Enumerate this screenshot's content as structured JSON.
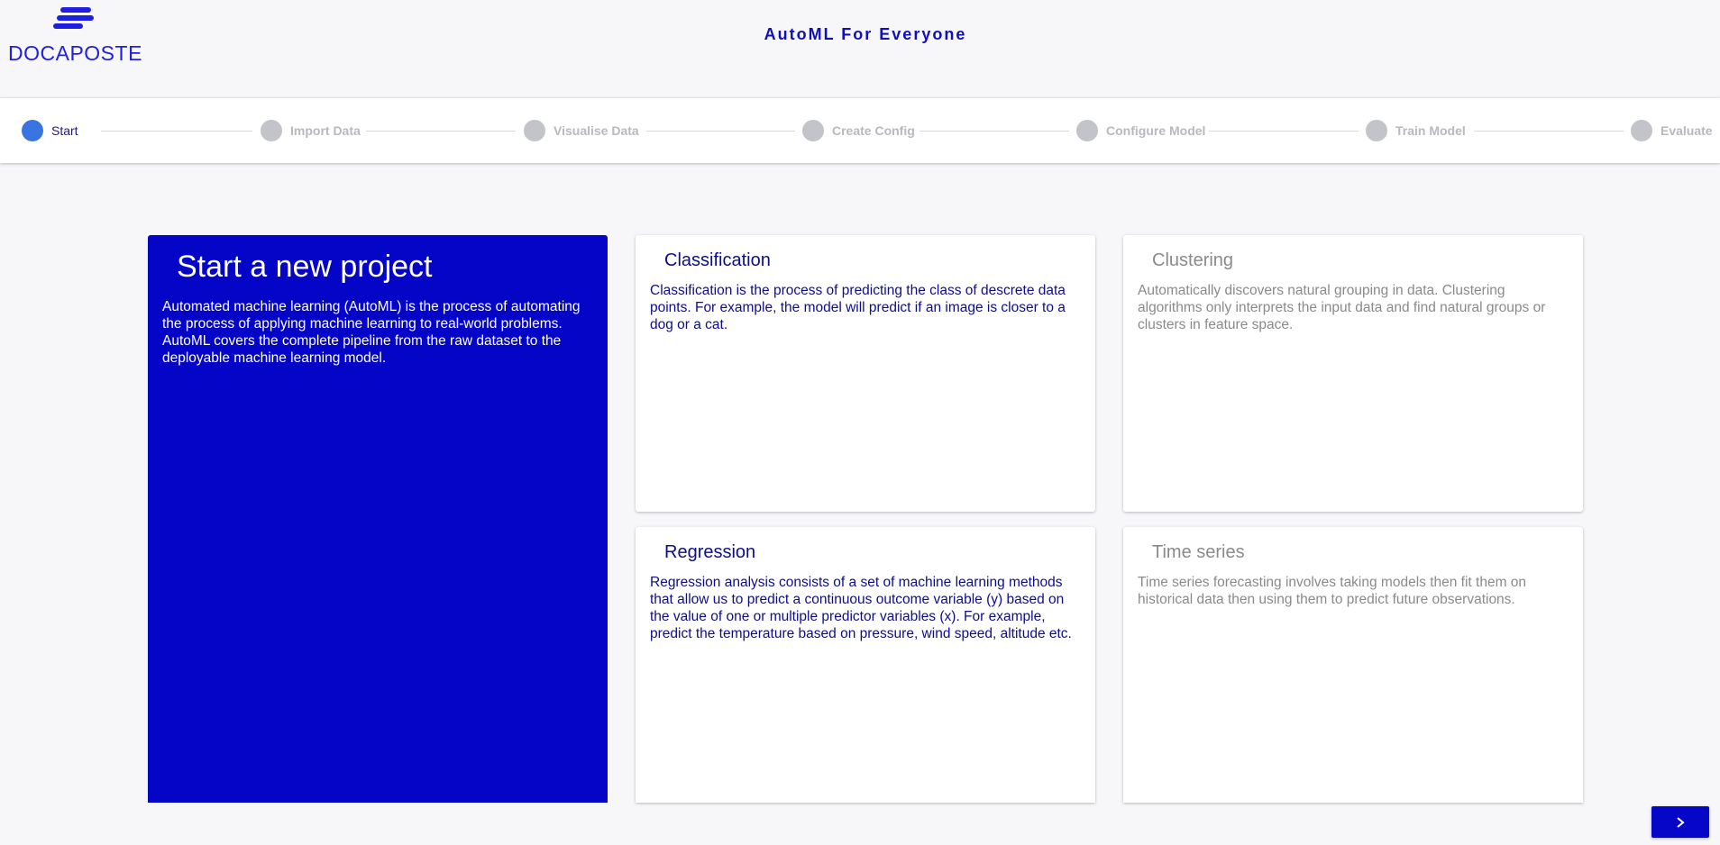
{
  "brand": {
    "logo_text": "DOCAPOSTE",
    "color": "#1f1fe0"
  },
  "header": {
    "title": "AutoML For Everyone"
  },
  "stepper": {
    "steps": [
      {
        "label": "Start",
        "active": true
      },
      {
        "label": "Import Data",
        "active": false
      },
      {
        "label": "Visualise Data",
        "active": false
      },
      {
        "label": "Create Config",
        "active": false
      },
      {
        "label": "Configure Model",
        "active": false
      },
      {
        "label": "Train Model",
        "active": false
      },
      {
        "label": "Evaluate",
        "active": false
      }
    ]
  },
  "hero": {
    "title": "Start a new project",
    "description": "Automated machine learning (AutoML) is the process of automating the process of applying machine learning to real-world problems. AutoML covers the complete pipeline from the raw dataset to the deployable machine learning model."
  },
  "cards": {
    "classification": {
      "title": "Classification",
      "description": "Classification is the process of predicting the class of descrete data points. For example, the model will predict if an image is closer to a dog or a cat."
    },
    "clustering": {
      "title": "Clustering",
      "description": "Automatically discovers natural grouping in data. Clustering algorithms only interprets the input data and find natural groups or clusters in feature space."
    },
    "regression": {
      "title": "Regression",
      "description": "Regression analysis consists of a set of machine learning methods that allow us to predict a continuous outcome variable (y) based on the value of one or multiple predictor variables (x). For example, predict the temperature based on pressure, wind speed, altitude etc."
    },
    "time_series": {
      "title": "Time series",
      "description": "Time series forecasting involves taking models then fit them on historical data then using them to predict future observations."
    }
  },
  "navigation": {
    "next_icon": "chevron-right-icon"
  },
  "colors": {
    "accent": "#0505c8",
    "active_step": "#3a74e0",
    "inactive_step": "#c2c4c9"
  }
}
